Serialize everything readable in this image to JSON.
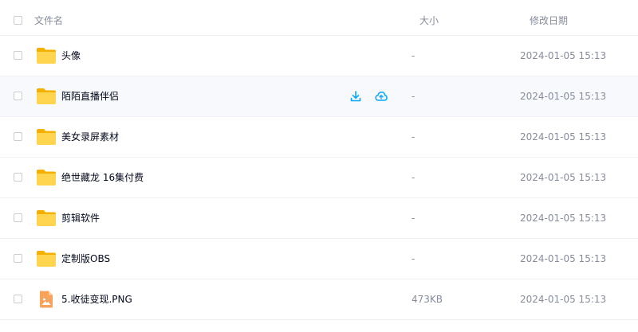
{
  "header": {
    "name_label": "文件名",
    "size_label": "大小",
    "date_label": "修改日期"
  },
  "accent_color": "#06a7ff",
  "rows": [
    {
      "name": "头像",
      "size": "-",
      "date": "2024-01-05 15:13",
      "icon": "folder-icon"
    },
    {
      "name": "陌陌直播伴侣",
      "size": "-",
      "date": "2024-01-05 15:13",
      "icon": "folder-icon",
      "hovered": true
    },
    {
      "name": "美女录屏素材",
      "size": "-",
      "date": "2024-01-05 15:13",
      "icon": "folder-icon"
    },
    {
      "name": "绝世藏龙 16集付费",
      "size": "-",
      "date": "2024-01-05 15:13",
      "icon": "folder-icon"
    },
    {
      "name": "剪辑软件",
      "size": "-",
      "date": "2024-01-05 15:13",
      "icon": "folder-icon"
    },
    {
      "name": "定制版OBS",
      "size": "-",
      "date": "2024-01-05 15:13",
      "icon": "folder-icon"
    },
    {
      "name": "5.收徒变现.PNG",
      "size": "473KB",
      "date": "2024-01-05 15:13",
      "icon": "image-file-icon"
    }
  ]
}
